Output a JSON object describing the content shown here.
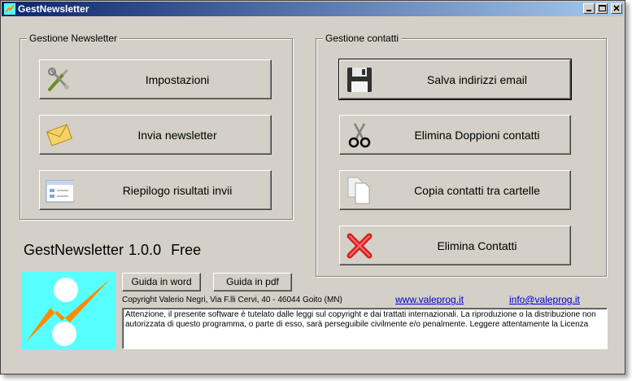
{
  "window": {
    "title": "GestNewsletter",
    "controls": [
      "minimize",
      "maximize",
      "close"
    ]
  },
  "newsletter_group": {
    "title": "Gestione Newsletter",
    "buttons": [
      {
        "label": "Impostazioni",
        "icon": "tools-icon"
      },
      {
        "label": "Invia newsletter",
        "icon": "envelope-icon"
      },
      {
        "label": "Riepilogo risultati invii",
        "icon": "report-window-icon"
      }
    ]
  },
  "contacts_group": {
    "title": "Gestione contatti",
    "buttons": [
      {
        "label": "Salva indirizzi email",
        "icon": "floppy-disk-icon"
      },
      {
        "label": "Elimina Doppioni contatti",
        "icon": "scissors-icon"
      },
      {
        "label": "Copia contatti tra cartelle",
        "icon": "copy-pages-icon"
      },
      {
        "label": "Elimina Contatti",
        "icon": "red-x-icon"
      }
    ]
  },
  "app": {
    "name": "GestNewsletter 1.0.0",
    "edition": "Free"
  },
  "guides": {
    "word": "Guida in word",
    "pdf": "Guida in pdf"
  },
  "footer": {
    "copyright": "Copyright Valerio Negri, Via F.lli Cervi, 40 - 46044 Goito (MN)",
    "website": "www.valeprog.it",
    "email": "info@valeprog.it",
    "notice": "Attenzione, il presente software è tutelato dalle leggi sul copyright e dai trattati internazionali. La riproduzione o la distribuzione non autorizzata di questo programma, o parte di esso, sarà perseguibile civilmente e/o penalmente. Leggere attentamente la Licenza"
  },
  "colors": {
    "face": "#d4d0c8",
    "title_start": "#0a246a",
    "title_end": "#a6caf0",
    "logo_bg": "#57ffff",
    "logo_accent": "#ff8c00",
    "link": "#0000cc"
  }
}
